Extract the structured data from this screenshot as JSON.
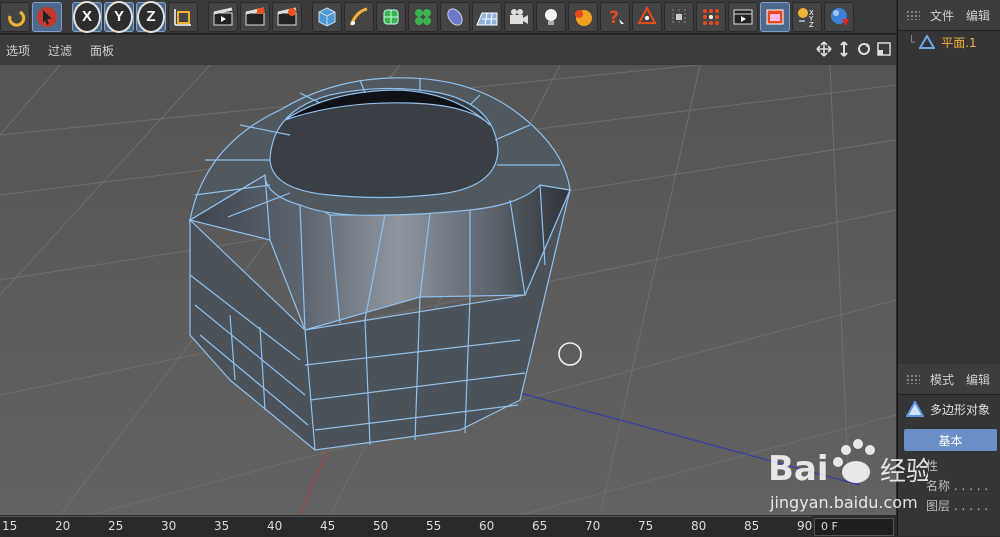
{
  "toolbar": {
    "axis_x": "X",
    "axis_y": "Y",
    "axis_z": "Z",
    "icons": [
      "undo-icon",
      "select-arrow-icon",
      "x-axis-icon",
      "y-axis-icon",
      "z-axis-icon",
      "coordinate-system-icon",
      "render-view-icon",
      "render-picture-viewer-icon",
      "render-settings-icon",
      "cube-icon",
      "pen-spline-icon",
      "subdivision-icon",
      "cloner-icon",
      "deformer-icon",
      "floor-icon",
      "camera-icon",
      "light-icon",
      "material-icon",
      "help-icon",
      "triangle-tags-icon",
      "snap-icon",
      "grid-dots-icon",
      "timeline-icon",
      "window-icon",
      "xyz-icon",
      "sphere-icon"
    ]
  },
  "viewport": {
    "menu": [
      "选项",
      "过滤",
      "面板"
    ]
  },
  "timeline": {
    "ticks": [
      "15",
      "20",
      "25",
      "30",
      "35",
      "40",
      "45",
      "50",
      "55",
      "60",
      "65",
      "70",
      "75",
      "80",
      "85",
      "90"
    ],
    "frame_value": "0 F"
  },
  "object_manager": {
    "tabs": [
      "文件",
      "编辑"
    ],
    "items": [
      "平面.1"
    ]
  },
  "attribute_manager": {
    "tabs": [
      "模式",
      "编辑"
    ],
    "object_type": "多边形对象",
    "active_tab": "基本",
    "rows": [
      "性",
      "名称 . . . . .",
      "图层 . . . . ."
    ]
  },
  "watermark": {
    "brand": "Bai",
    "brand2": "经验",
    "url": "jingyan.baidu.com"
  },
  "colors": {
    "accent": "#6a8fc7",
    "selected_item": "#f3b03a",
    "mesh_edge": "#7fb0e0",
    "viewport_bg": "#5b5b5b"
  }
}
